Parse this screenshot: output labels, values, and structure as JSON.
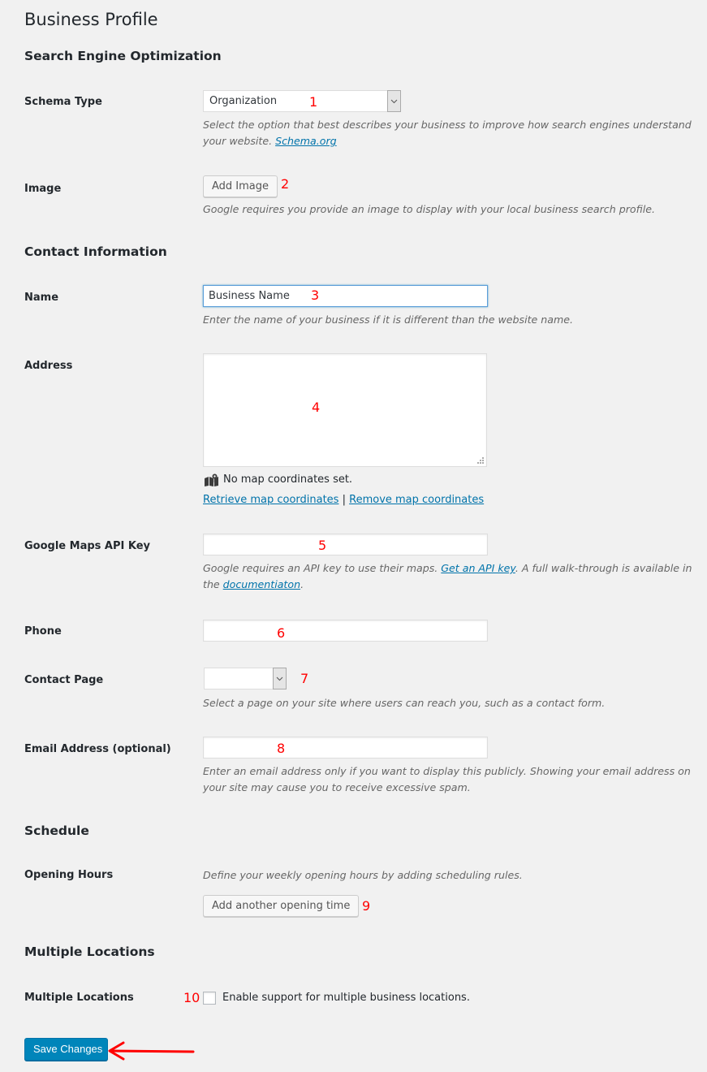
{
  "page": {
    "title": "Business Profile"
  },
  "sections": {
    "seo": "Search Engine Optimization",
    "contact": "Contact Information",
    "schedule": "Schedule",
    "multiple_locations": "Multiple Locations"
  },
  "schema_type": {
    "label": "Schema Type",
    "selected": "Organization",
    "description_before": "Select the option that best describes your business to improve how search engines understand your website. ",
    "link_text": "Schema.org",
    "annotation": "1"
  },
  "image": {
    "label": "Image",
    "button": "Add Image",
    "description": "Google requires you provide an image to display with your local business search profile.",
    "annotation": "2"
  },
  "name": {
    "label": "Name",
    "value": "Business Name",
    "description": "Enter the name of your business if it is different than the website name.",
    "annotation": "3"
  },
  "address": {
    "label": "Address",
    "value": "",
    "annotation": "4",
    "map_status": "No map coordinates set.",
    "retrieve_link": "Retrieve map coordinates",
    "separator": "|",
    "remove_link": "Remove map coordinates",
    "map_icon": "map-marker-icon"
  },
  "maps_api_key": {
    "label": "Google Maps API Key",
    "value": "",
    "annotation": "5",
    "description_part1": "Google requires an API key to use their maps. ",
    "link1": "Get an API key",
    "description_part2": ". A full walk-through is available in the ",
    "link2": "documentiaton",
    "description_part3": "."
  },
  "phone": {
    "label": "Phone",
    "value": "",
    "annotation": "6"
  },
  "contact_page": {
    "label": "Contact Page",
    "selected": "",
    "annotation": "7",
    "description": "Select a page on your site where users can reach you, such as a contact form."
  },
  "email": {
    "label": "Email Address (optional)",
    "value": "",
    "annotation": "8",
    "description": "Enter an email address only if you want to display this publicly. Showing your email address on your site may cause you to receive excessive spam."
  },
  "opening_hours": {
    "label": "Opening Hours",
    "description": "Define your weekly opening hours by adding scheduling rules.",
    "button": "Add another opening time",
    "annotation": "9"
  },
  "multiple_locations": {
    "label": "Multiple Locations",
    "checkbox_label": "Enable support for multiple business locations.",
    "checked": false,
    "annotation": "10"
  },
  "save": {
    "button": "Save Changes"
  },
  "colors": {
    "primary_button": "#0085ba",
    "link": "#0073aa",
    "annotation": "#ff0000",
    "background": "#f1f1f1"
  }
}
